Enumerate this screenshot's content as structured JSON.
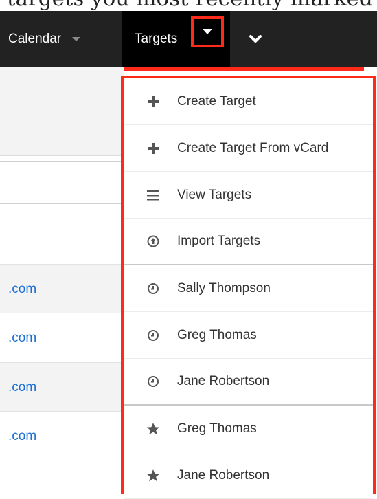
{
  "caption": {
    "text": "targets you most recently marked"
  },
  "nav": {
    "calendar_label": "Calendar",
    "targets_label": "Targets"
  },
  "background_rows": [
    {
      "link": ".com"
    },
    {
      "link": ".com"
    },
    {
      "link": ".com"
    },
    {
      "link": ".com"
    }
  ],
  "menu": {
    "items": [
      {
        "label": "Create Target",
        "icon": "plus-icon"
      },
      {
        "label": "Create Target From vCard",
        "icon": "plus-icon"
      },
      {
        "label": "View Targets",
        "icon": "list-icon"
      },
      {
        "label": "Import Targets",
        "icon": "import-icon"
      },
      {
        "label": "Sally Thompson",
        "icon": "clock-icon"
      },
      {
        "label": "Greg Thomas",
        "icon": "clock-icon"
      },
      {
        "label": "Jane Robertson",
        "icon": "clock-icon"
      },
      {
        "label": "Greg Thomas",
        "icon": "star-icon"
      },
      {
        "label": "Jane Robertson",
        "icon": "star-icon"
      }
    ]
  },
  "colors": {
    "nav_bg": "#222222",
    "active_tab_bg": "#000000",
    "highlight": "#ff2a1a",
    "link": "#1a6fd6"
  }
}
